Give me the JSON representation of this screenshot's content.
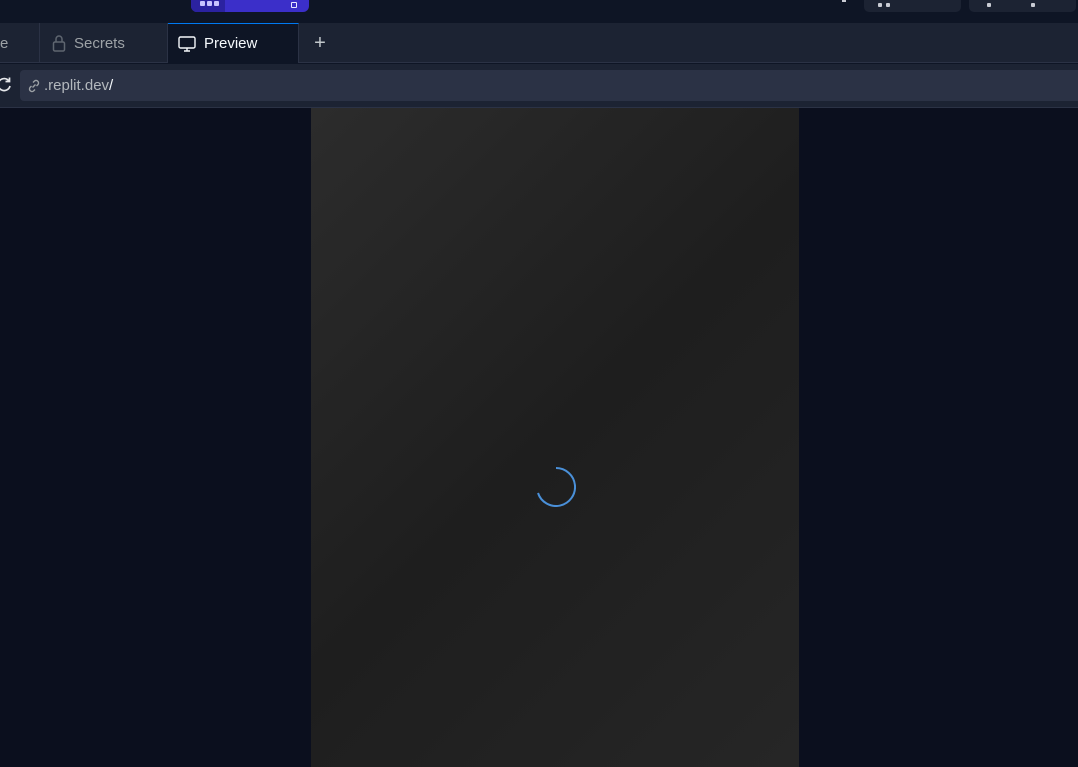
{
  "top_bar": {
    "run_button": {
      "color": "#3b2fc9",
      "icon": "run-dots-icon"
    }
  },
  "tabs": {
    "cut_tab_label": "e",
    "secrets": {
      "label": "Secrets",
      "icon": "lock-icon"
    },
    "preview": {
      "label": "Preview",
      "icon": "monitor-icon",
      "active": true
    },
    "add_tab": {
      "label": "+"
    }
  },
  "url_bar": {
    "domain": ".replit.dev",
    "path": "/",
    "icons": [
      "reload-icon",
      "link-icon"
    ]
  },
  "preview": {
    "state": "loading",
    "spinner_color": "#4a90d9"
  },
  "colors": {
    "accent": "#0079f2",
    "background": "#0e1525",
    "surface": "#1c2333"
  }
}
